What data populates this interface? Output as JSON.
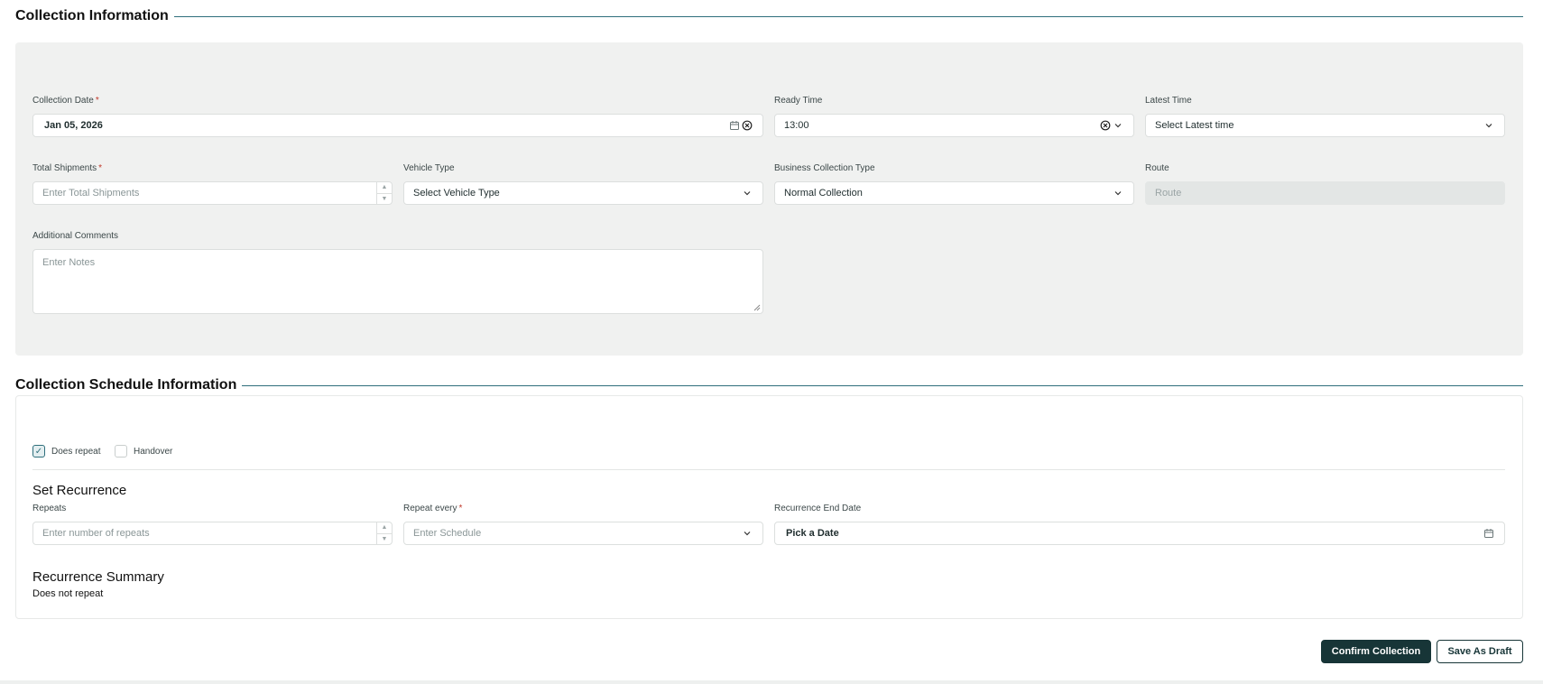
{
  "collection_info": {
    "title": "Collection Information",
    "collection_date": {
      "label": "Collection Date",
      "required_mark": "*",
      "value": "Jan 05, 2026"
    },
    "ready_time": {
      "label": "Ready Time",
      "value": "13:00"
    },
    "latest_time": {
      "label": "Latest Time",
      "placeholder": "Select Latest time"
    },
    "total_shipments": {
      "label": "Total Shipments",
      "required_mark": "*",
      "placeholder": "Enter Total Shipments"
    },
    "vehicle_type": {
      "label": "Vehicle Type",
      "value": "Select Vehicle Type"
    },
    "business_collection_type": {
      "label": "Business Collection Type",
      "value": "Normal Collection"
    },
    "route": {
      "label": "Route",
      "placeholder": "Route"
    },
    "additional_comments": {
      "label": "Additional Comments",
      "placeholder": "Enter Notes"
    }
  },
  "schedule_info": {
    "title": "Collection Schedule Information",
    "does_repeat": {
      "label": "Does repeat",
      "checked": true
    },
    "handover": {
      "label": "Handover",
      "checked": false
    },
    "set_recurrence_title": "Set Recurrence",
    "repeats": {
      "label": "Repeats",
      "placeholder": "Enter number of repeats"
    },
    "repeat_every": {
      "label": "Repeat every",
      "required_mark": "*",
      "placeholder": "Enter Schedule"
    },
    "recurrence_end_date": {
      "label": "Recurrence End Date",
      "value": "Pick a Date"
    },
    "summary_title": "Recurrence Summary",
    "summary_text": "Does not repeat"
  },
  "actions": {
    "confirm_label": "Confirm Collection",
    "draft_label": "Save As Draft"
  },
  "icons": {
    "calendar": "calendar-icon",
    "clear": "clear-circle-icon",
    "chevron": "chevron-down-icon",
    "check": "check-icon"
  },
  "colors": {
    "accent": "#2f6f7c",
    "primary_button": "#173537",
    "required": "#c0392b",
    "panel_bg": "#f0f1f0"
  }
}
